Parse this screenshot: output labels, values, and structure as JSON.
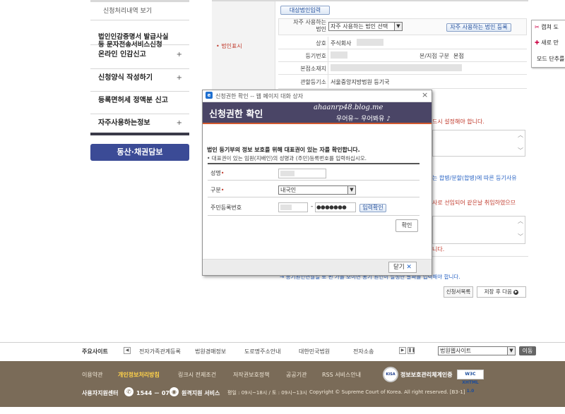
{
  "sidebar": {
    "top_item": "신청처리내역 보기",
    "items": [
      {
        "label": "법인인감증명서 발급사실\n등 문자전송서비스신청",
        "plus": ""
      },
      {
        "label": "온라인 인감신고",
        "plus": "+"
      },
      {
        "label": "신청양식 작성하기",
        "plus": "+"
      },
      {
        "label": "등록면허세 정액분 신고",
        "plus": ""
      },
      {
        "label": "자주사용하는정보",
        "plus": "+"
      }
    ],
    "banner": "동산·채권담보"
  },
  "form": {
    "section_label": "• 법인표시",
    "target_btn": "대상법인입력",
    "favorite_label": "자주 사용하는\n법인",
    "favorite_select": "자주 사용하는 법인 선택",
    "favorite_register_btn": "자주 사용하는 법인 등록",
    "rows": [
      {
        "label": "상호",
        "value": "주식회사"
      },
      {
        "label": "등기번호",
        "value": ""
      },
      {
        "label": "본점소재지",
        "value": ""
      },
      {
        "label": "관할등기소",
        "value": "서울중앙지방법원 등기국"
      }
    ],
    "branch_label": "본/지점 구분",
    "branch_value": "본점",
    "note_right_1": "드시 설정해야 합니다.",
    "note_right_2": "는 합병/분할(합병)에 따른 등기사유",
    "note_right_3": "사로 선임되어 같은날 취임하였으므",
    "note_right_4": "니다.",
    "note_bottom": "→ 등기원인연월일 로 된 가를 보이면 동기 원인이 발생한 날짜를 입력해야 합니다.",
    "btn_list": "신청서목록",
    "btn_save_next": "저장 후 다음"
  },
  "popup_menu": {
    "items": [
      "캡쳐 도",
      "새로 만",
      "모드 단추를"
    ]
  },
  "dialog": {
    "window_title": "신청권한 확인 -- 웹 페이지 대화 상자",
    "close_glyph": "×",
    "header_title": "신청권한 확인",
    "watermark_1": "ahaanrp48.blog.me",
    "watermark_2": "우어유~ 우어봐유 ♪",
    "desc_bold": "법인 등기부의 정보 보호를 위해 대표권이 있는 자를 확인합니다.",
    "desc_sub": "• 대표권이 있는 임원(지배인)의 성명과 (주민)등록번호를 입력하십시오.",
    "name_label": "성명",
    "type_label": "구분",
    "type_value": "내국인",
    "rrn_label": "주민등록번호",
    "rrn_masked": "●●●●●●●",
    "rrn_dash": "-",
    "input_confirm_btn": "입력확인",
    "confirm_btn": "확인",
    "close_btn": "닫기"
  },
  "footer": {
    "main_sites_label": "주요사이트",
    "sites": [
      "전자가족관계등록",
      "법원경매정보",
      "도로명주소안내",
      "대한민국법원",
      "전자소송"
    ],
    "court_select": "법원웹사이트",
    "go_btn": "이동",
    "links": [
      "이용약관",
      "개인정보처리방침",
      "링크시 전제조건",
      "저작권보호정책",
      "공공기관",
      "RSS 서비스안내"
    ],
    "cert_label": "정보보호관리체계인증",
    "w3c_label": "W3C XHTML 1.0",
    "help_center": "사용자지원센터",
    "phone": "1544 － 0770",
    "remote_service": "원격지원 서비스",
    "hours": "평일 : 09시~18시 / 토 : 09시~13시",
    "copyright": "Copyright © Supreme Court of Korea. All right reserved. [B3-1]"
  },
  "colors": {
    "nav_banner": "#3b4b96",
    "dialog_header": "#4a4566",
    "footer_brown": "#7a6b58",
    "highlight": "#ffd24a"
  }
}
